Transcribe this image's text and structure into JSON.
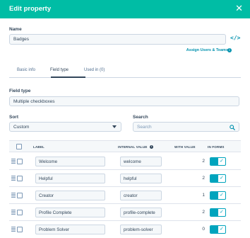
{
  "header": {
    "title": "Edit property",
    "close_icon": "close-icon"
  },
  "name": {
    "label": "Name",
    "value": "Badges"
  },
  "assign_link": "Assign Users & Teams",
  "tabs": [
    {
      "label": "Basic info"
    },
    {
      "label": "Field type"
    },
    {
      "label": "Used in (0)"
    }
  ],
  "field_type": {
    "label": "Field type",
    "value": "Multiple checkboxes"
  },
  "sort": {
    "label": "Sort",
    "value": "Custom"
  },
  "search": {
    "label": "Search",
    "placeholder": "Search"
  },
  "table": {
    "headers": {
      "label": "LABEL",
      "internal_value": "INTERNAL VALUE",
      "with_value": "WITH VALUE",
      "in_forms": "IN FORMS"
    },
    "rows": [
      {
        "label": "Welcome",
        "internal": "welcome",
        "count": "2",
        "in_forms": true
      },
      {
        "label": "Helpful",
        "internal": "helpful",
        "count": "2",
        "in_forms": true
      },
      {
        "label": "Creator",
        "internal": "creator",
        "count": "1",
        "in_forms": true
      },
      {
        "label": "Profile Complete",
        "internal": "profile-complete",
        "count": "2",
        "in_forms": true
      },
      {
        "label": "Problem Solver",
        "internal": "problem-solver",
        "count": "0",
        "in_forms": true
      }
    ]
  },
  "colors": {
    "header": "#00bda5",
    "accent": "#00a4bd",
    "link": "#0091ae",
    "text": "#33475b"
  }
}
